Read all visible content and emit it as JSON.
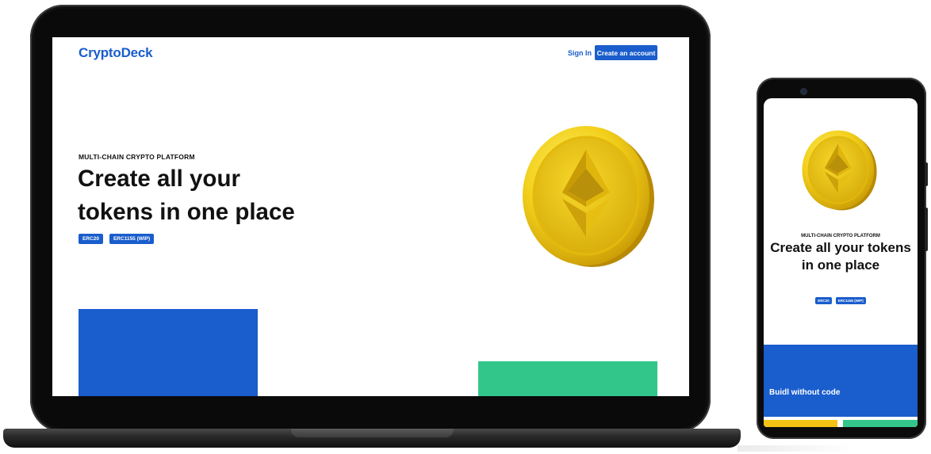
{
  "brand": {
    "logo_text": "CryptoDeck",
    "primary_color": "#1a5dcc",
    "accent_green": "#33c68b",
    "accent_yellow": "#f2c215"
  },
  "nav": {
    "sign_in": "Sign In",
    "create_account": "Create an account"
  },
  "hero": {
    "eyebrow": "MULTI-CHAIN CRYPTO PLATFORM",
    "title_line1": "Create all your",
    "title_line2": "tokens in one place",
    "tags": [
      "ERC20",
      "ERC1155 (WIP)"
    ],
    "illustration": "ethereum-coin-icon"
  },
  "mobile": {
    "eyebrow": "MULTI-CHAIN CRYPTO PLATFORM",
    "title": "Create all your tokens in one place",
    "tags": [
      "ERC20",
      "ERC1155 (WIP)"
    ],
    "feature_card_text": "Buidl without code"
  }
}
